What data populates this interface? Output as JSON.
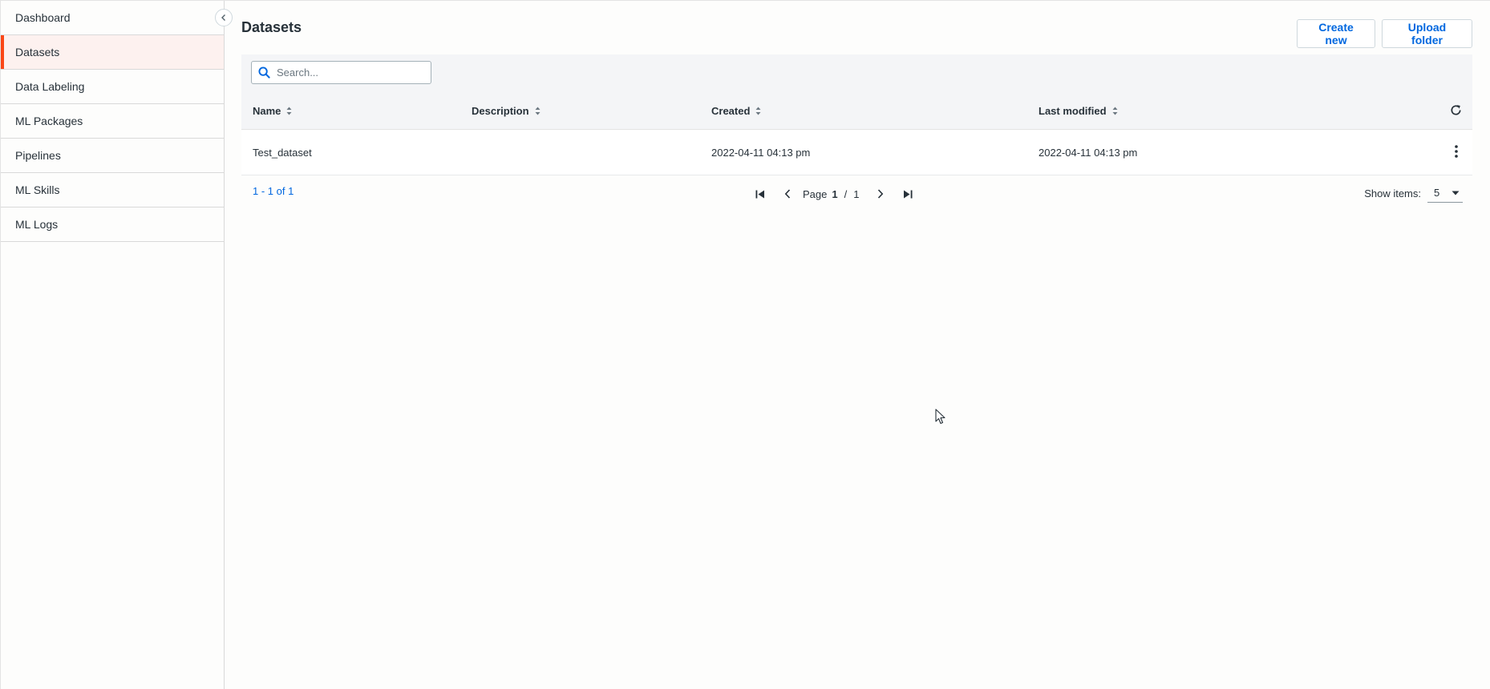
{
  "sidebar": {
    "items": [
      {
        "label": "Dashboard"
      },
      {
        "label": "Datasets"
      },
      {
        "label": "Data Labeling"
      },
      {
        "label": "ML Packages"
      },
      {
        "label": "Pipelines"
      },
      {
        "label": "ML Skills"
      },
      {
        "label": "ML Logs"
      }
    ],
    "active_index": 1
  },
  "header": {
    "title": "Datasets",
    "create_label": "Create new",
    "upload_label": "Upload folder"
  },
  "search": {
    "placeholder": "Search...",
    "value": ""
  },
  "table": {
    "columns": [
      "Name",
      "Description",
      "Created",
      "Last modified"
    ],
    "rows": [
      {
        "name": "Test_dataset",
        "description": "",
        "created": "2022-04-11 04:13 pm",
        "modified": "2022-04-11 04:13 pm"
      }
    ]
  },
  "pagination": {
    "range_text": "1 - 1 of 1",
    "page_label": "Page",
    "current_page": "1",
    "separator": "/",
    "total_pages": "1",
    "show_items_label": "Show items:",
    "items_per_page": "5"
  },
  "colors": {
    "accent": "#fa4616",
    "link": "#0067df",
    "header_bg": "#f4f5f7"
  }
}
